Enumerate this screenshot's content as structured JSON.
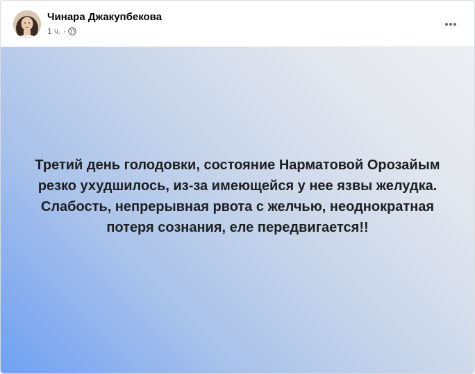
{
  "post": {
    "author_name": "Чинара Джакупбекова",
    "timestamp": "1 ч.",
    "separator": "·",
    "audience_icon": "globe-icon",
    "more_icon": "more-horizontal-icon",
    "text_card": {
      "body": "Третий день голодовки, состояние Нарматовой Орозайым резко ухудшилось, из-за имеющейся у нее язвы желудка. Слабость, непрерывная рвота с желчью, неоднократная потеря сознания, еле передвигается!!",
      "background_from": "#6fa0f2",
      "background_to": "#eceef2"
    }
  }
}
